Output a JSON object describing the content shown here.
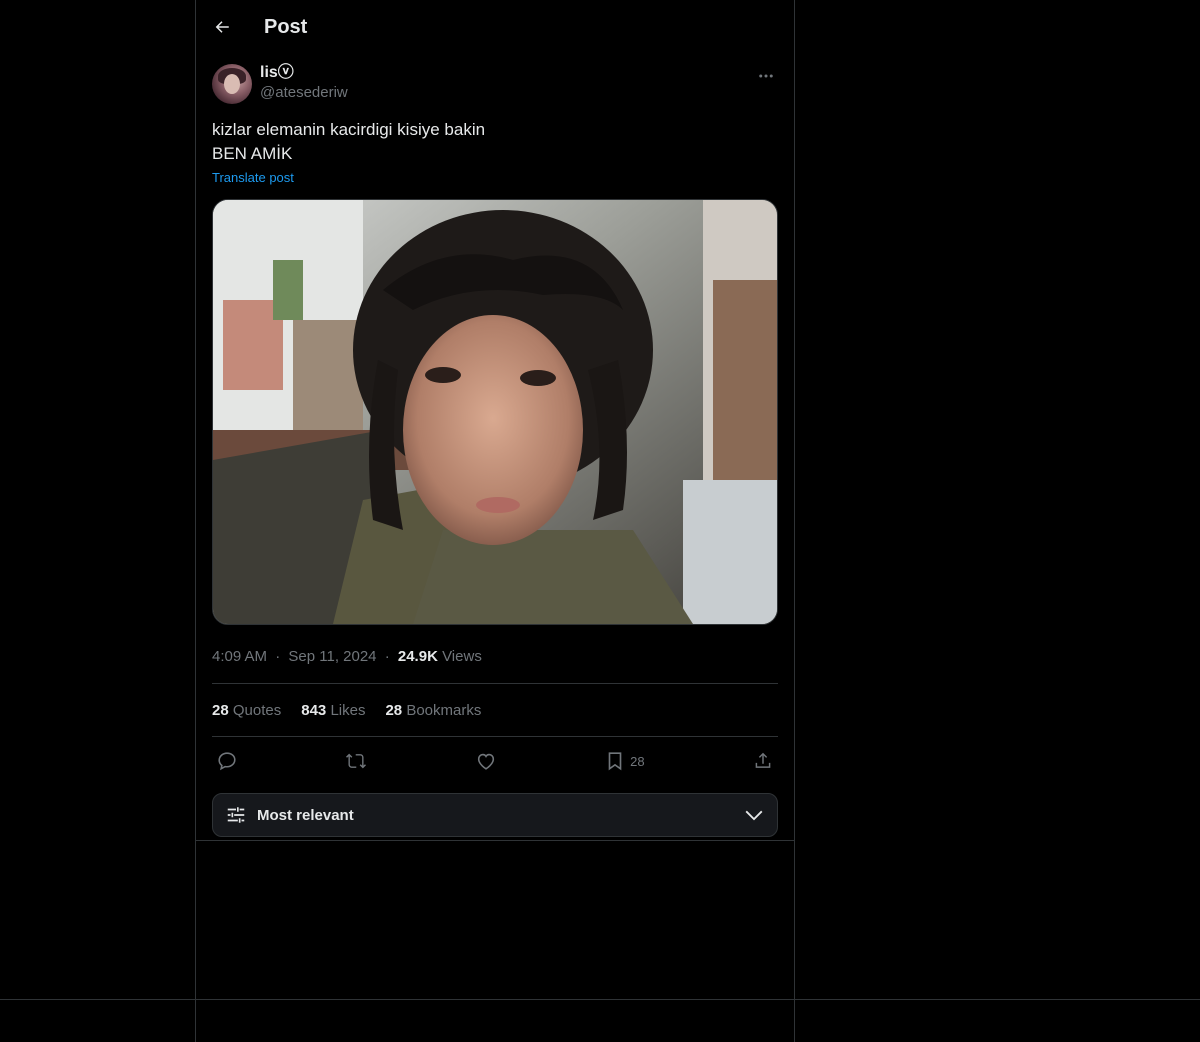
{
  "header": {
    "title": "Post"
  },
  "post": {
    "author": {
      "display_name": "lisⓥ",
      "handle": "@atesederiw"
    },
    "text_line1": "kizlar elemanin kacirdigi kisiye bakin",
    "text_line2": "BEN AMİK",
    "translate_label": "Translate post",
    "time": "4:09 AM",
    "date": "Sep 11, 2024",
    "views_count": "24.9K",
    "views_label": "Views",
    "separator": "·"
  },
  "stats": {
    "quotes_count": "28",
    "quotes_label": "Quotes",
    "likes_count": "843",
    "likes_label": "Likes",
    "bookmarks_count": "28",
    "bookmarks_label": "Bookmarks"
  },
  "actions": {
    "bookmark_count": "28"
  },
  "sort": {
    "label": "Most relevant"
  },
  "icons": {
    "back": "arrow-left-icon",
    "more": "more-horizontal-icon",
    "reply": "reply-icon",
    "repost": "repost-icon",
    "like": "heart-icon",
    "bookmark": "bookmark-icon",
    "share": "share-icon",
    "filter": "filter-sliders-icon",
    "chevron": "chevron-down-icon"
  },
  "colors": {
    "background": "#000000",
    "text_primary": "#e7e9ea",
    "text_secondary": "#71767b",
    "link": "#1d9bf0",
    "border": "#2f3336"
  }
}
